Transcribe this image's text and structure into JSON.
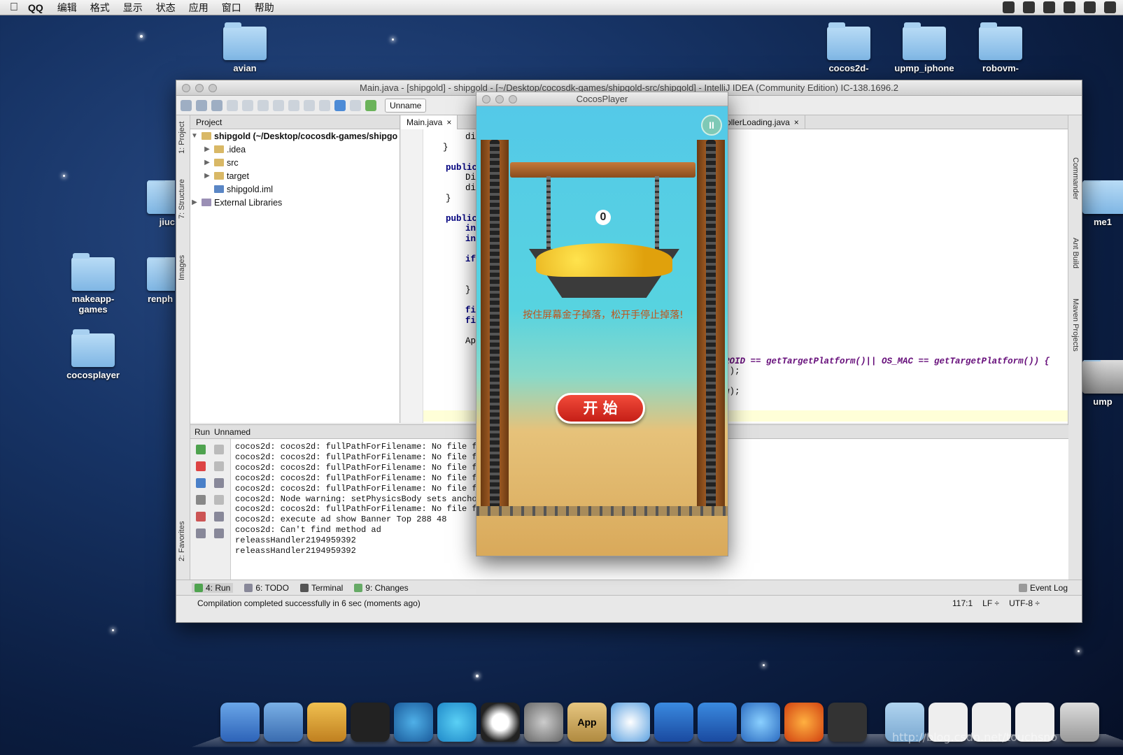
{
  "menubar": {
    "app": "QQ",
    "items": [
      "编辑",
      "格式",
      "显示",
      "状态",
      "应用",
      "窗口",
      "帮助"
    ]
  },
  "desktop": {
    "icons": [
      {
        "label": "avian"
      },
      {
        "label": "cocos2d-"
      },
      {
        "label": "upmp_iphone"
      },
      {
        "label": "robovm-"
      },
      {
        "label": "jiuc"
      },
      {
        "label": "makeapp-\ngames"
      },
      {
        "label": "renph"
      },
      {
        "label": "cocosplayer"
      },
      {
        "label": "me1"
      },
      {
        "label": "ump"
      }
    ]
  },
  "ide": {
    "title": "Main.java - [shipgold] - shipgold - [~/Desktop/cocosdk-games/shipgold-src/shipgold] - IntelliJ IDEA (Community Edition) IC-138.1696.2",
    "run_config": "Unname",
    "left_tabs": [
      "1: Project",
      "7: Structure",
      "Images",
      "2: Favorites"
    ],
    "right_tabs": [
      "Commander",
      "Ant Build",
      "Maven Projects"
    ],
    "project_panel": {
      "header": "Project",
      "tree": [
        {
          "label": "shipgold (~/Desktop/cocosdk-games/shipgo",
          "expanded": true,
          "indent": 0
        },
        {
          "label": ".idea",
          "expanded": false,
          "indent": 1
        },
        {
          "label": "src",
          "expanded": false,
          "indent": 1
        },
        {
          "label": "target",
          "expanded": false,
          "indent": 1
        },
        {
          "label": "shipgold.iml",
          "expanded": null,
          "indent": 1
        },
        {
          "label": "External Libraries",
          "expanded": false,
          "indent": 0
        }
      ]
    },
    "editor": {
      "tabs": [
        "Main.java",
        "ontrollerLoading.java"
      ],
      "code_lines": [
        "di",
        "}",
        "",
        "public",
        "Di",
        "di",
        "}",
        "",
        "public",
        "in",
        "in",
        "",
        "if",
        "",
        "",
        "}",
        "",
        "fi",
        "fi",
        "",
        "Ap"
      ],
      "code_right": [
        ");",
        "NDROID == getTargetPlatform()|| OS_MAC == getTargetPlatform()) {",
        "er\");",
        "",
        "iew);"
      ]
    },
    "run_panel": {
      "title": "Run",
      "config": "Unnamed",
      "console": [
        "cocos2d: cocos2d: fullPathForFilename: No file fo",
        "cocos2d: cocos2d: fullPathForFilename: No file fo",
        "cocos2d: cocos2d: fullPathForFilename: No file fo",
        "cocos2d: cocos2d: fullPathForFilename: No file fo",
        "cocos2d: cocos2d: fullPathForFilename: No file fo",
        "cocos2d: Node warning: setPhysicsBody sets ancho",
        "cocos2d: cocos2d: fullPathForFilename: No file fo",
        "cocos2d: execute ad show Banner Top 288 48",
        "cocos2d: Can't find method ad",
        "releassHandler2194959392",
        "releassHandler2194959392"
      ]
    },
    "bottom_tabs": [
      "4: Run",
      "6: TODO",
      "Terminal",
      "9: Changes"
    ],
    "event_log": "Event Log",
    "status": {
      "message": "Compilation completed successfully in 6 sec (moments ago)",
      "position": "117:1",
      "line_sep": "LF ÷",
      "encoding": "UTF-8 ÷"
    }
  },
  "cocos": {
    "title": "CocosPlayer",
    "score": "0",
    "hint": "按住屏幕金子掉落，松开手停止掉落!",
    "start_button": "开 始"
  },
  "watermark": "http://blog.csdn.net/touchsno"
}
